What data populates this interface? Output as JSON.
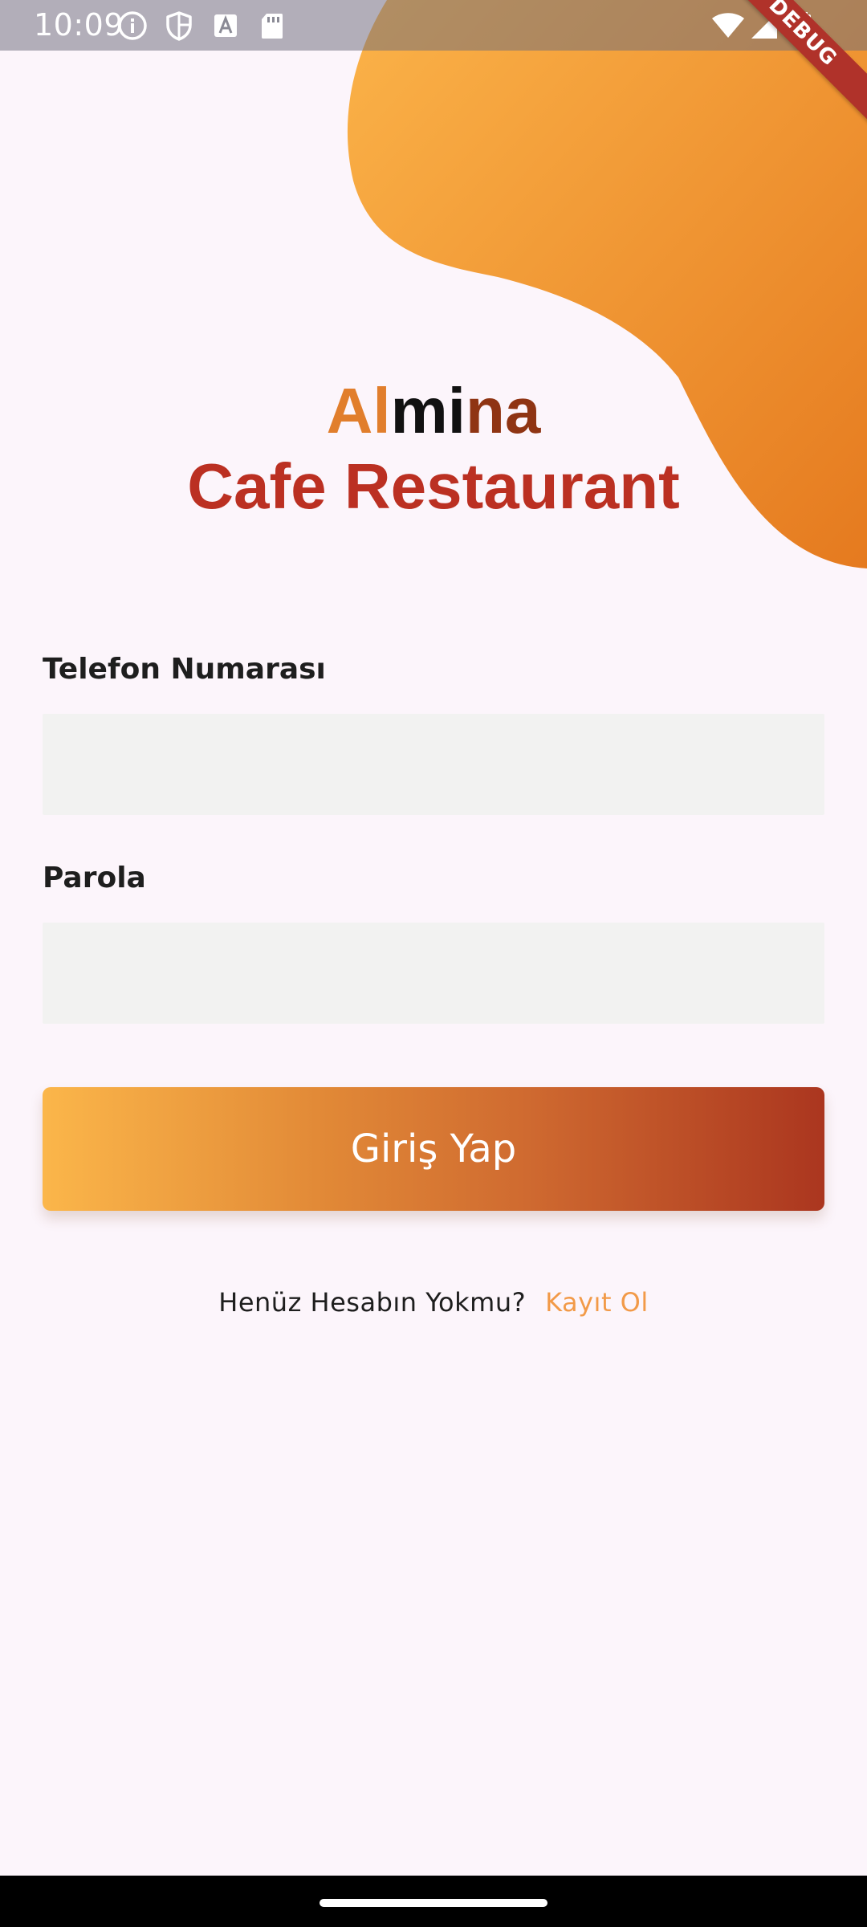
{
  "status_bar": {
    "time": "10:09",
    "left_icons": [
      "info-icon",
      "shield-icon",
      "font-a-icon",
      "sd-card-icon"
    ],
    "right_icons": [
      "wifi-icon",
      "cell-signal-icon",
      "battery-icon"
    ]
  },
  "debug_banner": "DEBUG",
  "brand": {
    "name_part_1": "Al",
    "name_part_2": "mi",
    "name_part_3": "na",
    "subtitle": "Cafe Restaurant"
  },
  "form": {
    "phone_label": "Telefon Numarası",
    "phone_value": "",
    "password_label": "Parola",
    "password_value": "",
    "login_button": "Giriş Yap"
  },
  "footer": {
    "question": "Henüz Hesabın Yokmu?",
    "signup_link": "Kayıt Ol"
  },
  "colors": {
    "background": "#fcf5fb",
    "blob_light": "#fbb349",
    "blob_dark": "#e57a1f",
    "brand_orange": "#e17e2c",
    "brand_brown": "#8f3413",
    "subtitle_red": "#bb3022",
    "input_background": "#f2f2f1",
    "button_gradient_start": "#fbb64a",
    "button_gradient_end": "#ab361f",
    "link": "#f29a48"
  }
}
